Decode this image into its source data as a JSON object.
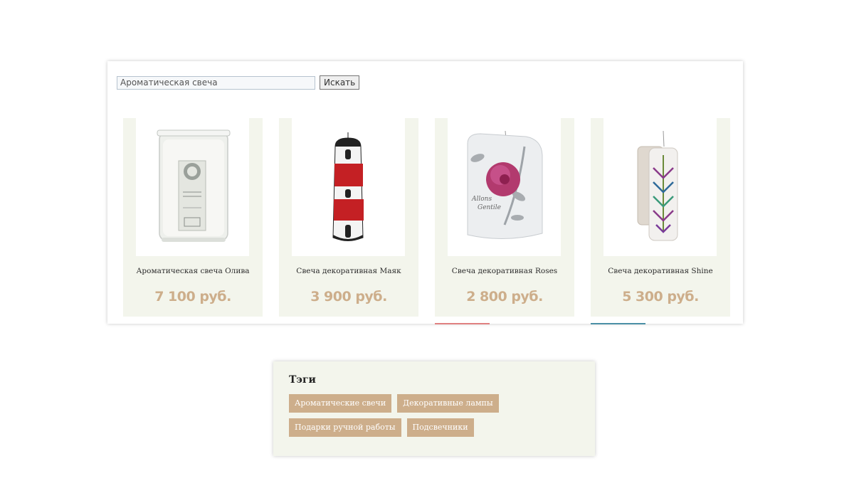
{
  "search": {
    "value": "Ароматическая свеча",
    "button_label": "Искать"
  },
  "products": [
    {
      "name": "Ароматическая свеча Олива",
      "price": "7 100 руб.",
      "image": "candle-jar-image"
    },
    {
      "name": "Свеча декоративная Маяк",
      "price": "3 900 руб.",
      "image": "lighthouse-candle-image"
    },
    {
      "name": "Свеча декоративная Roses",
      "price": "2 800 руб.",
      "image": "rose-candle-image"
    },
    {
      "name": "Свеча декоративная Shine",
      "price": "5 300 руб.",
      "image": "shine-candle-image"
    }
  ],
  "tags_widget": {
    "title": "Тэги",
    "tags": [
      "Ароматические свечи",
      "Декоративные лампы",
      "Подарки ручной работы",
      "Подсвечники"
    ]
  },
  "colors": {
    "accent": "#cdae8b",
    "card_bg": "#f3f5ec",
    "underline_red": "#e08080",
    "underline_teal": "#4a8fa6"
  }
}
